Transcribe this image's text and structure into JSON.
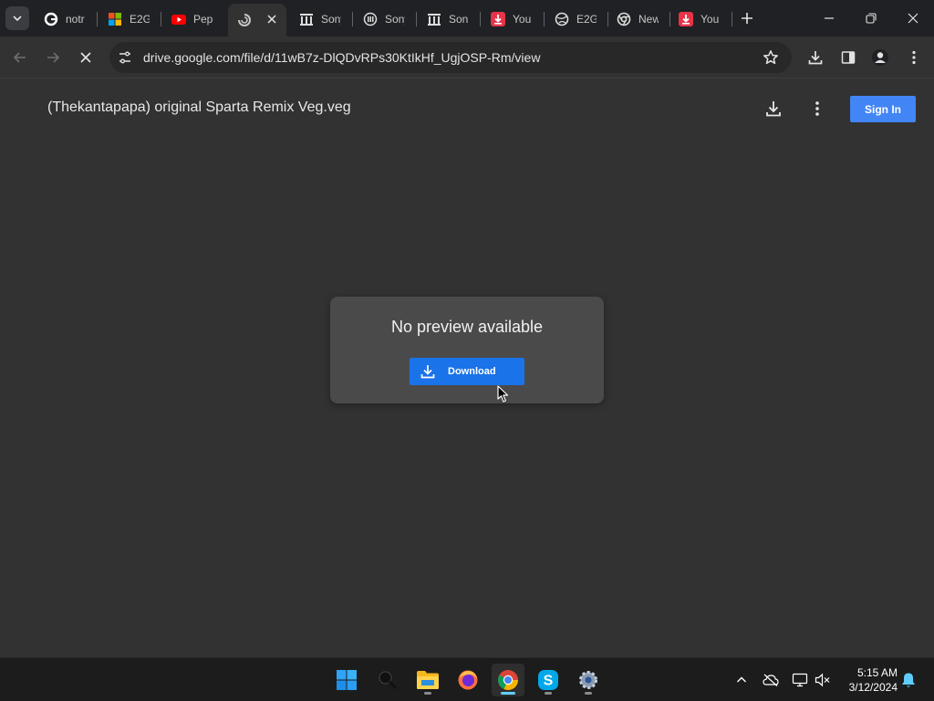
{
  "browser": {
    "tabs": [
      {
        "title": "notr",
        "icon": "google-icon"
      },
      {
        "title": "E2G",
        "icon": "windows-icon"
      },
      {
        "title": "Pep",
        "icon": "youtube-icon"
      },
      {
        "title": "",
        "icon": "loading-icon",
        "active": true
      },
      {
        "title": "Sony",
        "icon": "museum-icon"
      },
      {
        "title": "Sony",
        "icon": "internet-archive-icon"
      },
      {
        "title": "Son",
        "icon": "museum-icon"
      },
      {
        "title": "You",
        "icon": "download-app-icon"
      },
      {
        "title": "E2G",
        "icon": "globe-icon"
      },
      {
        "title": "New",
        "icon": "chrome-icon"
      },
      {
        "title": "You",
        "icon": "download-app-icon"
      }
    ],
    "url": "drive.google.com/file/d/11wB7z-DlQDvRPs30KtIkHf_UgjOSP-Rm/view"
  },
  "viewer": {
    "file_title": "(Thekantapapa) original Sparta Remix Veg.veg",
    "sign_in_label": "Sign In",
    "no_preview_text": "No preview available",
    "download_label": "Download"
  },
  "taskbar": {
    "apps": [
      "windows-start-icon",
      "search-icon",
      "file-explorer-icon",
      "firefox-icon",
      "chrome-icon",
      "skype-icon",
      "settings-icon"
    ],
    "time": "5:15 AM",
    "date": "3/12/2024"
  },
  "colors": {
    "accent_blue": "#1a73e8",
    "sign_in_blue": "#4285f4",
    "viewer_bg": "#323232",
    "tabstrip_bg": "#202124"
  }
}
